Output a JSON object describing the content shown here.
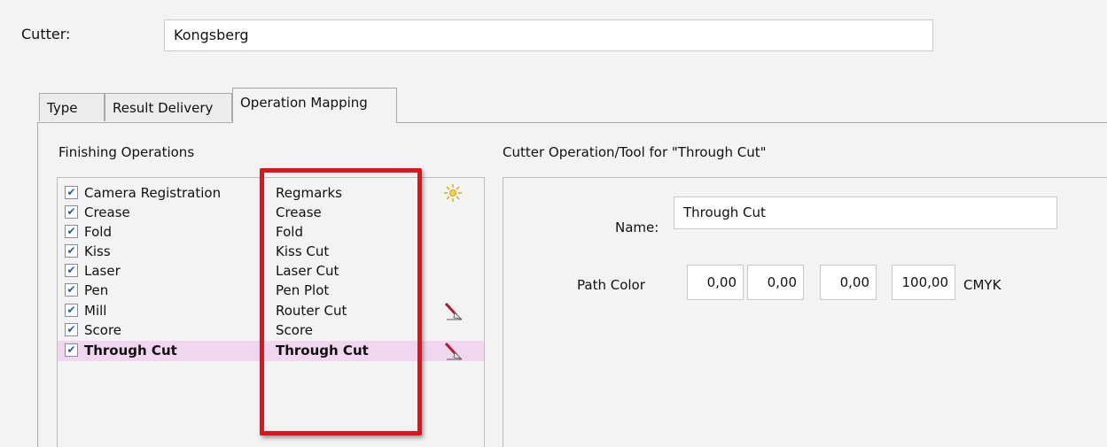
{
  "cutter": {
    "label": "Cutter:",
    "value": "Kongsberg"
  },
  "tabs": [
    {
      "label": "Type"
    },
    {
      "label": "Result Delivery"
    },
    {
      "label": "Operation Mapping",
      "active": true
    }
  ],
  "finishing": {
    "header": "Finishing Operations",
    "operations": [
      {
        "name": "Camera Registration",
        "mapped": "Regmarks",
        "checked": true,
        "icon": "sun-icon"
      },
      {
        "name": "Crease",
        "mapped": "Crease",
        "checked": true
      },
      {
        "name": "Fold",
        "mapped": "Fold",
        "checked": true
      },
      {
        "name": "Kiss",
        "mapped": "Kiss Cut",
        "checked": true
      },
      {
        "name": "Laser",
        "mapped": "Laser Cut",
        "checked": true
      },
      {
        "name": "Pen",
        "mapped": "Pen Plot",
        "checked": true
      },
      {
        "name": "Mill",
        "mapped": "Router Cut",
        "checked": true,
        "icon": "knife-tool-icon"
      },
      {
        "name": "Score",
        "mapped": "Score",
        "checked": true
      },
      {
        "name": "Through Cut",
        "mapped": "Through Cut",
        "checked": true,
        "selected": true,
        "icon": "knife-tool-icon"
      }
    ]
  },
  "detail": {
    "header": "Cutter Operation/Tool for \"Through Cut\"",
    "name_label": "Name:",
    "name_value": "Through Cut",
    "path_color_label": "Path Color",
    "path_color": {
      "c": "0,00",
      "m": "0,00",
      "y": "0,00",
      "k": "100,00",
      "model": "CMYK"
    }
  },
  "colors": {
    "highlight": "#e0131a",
    "selected_row": "#f0d6ee",
    "background": "#f3f3f3"
  }
}
